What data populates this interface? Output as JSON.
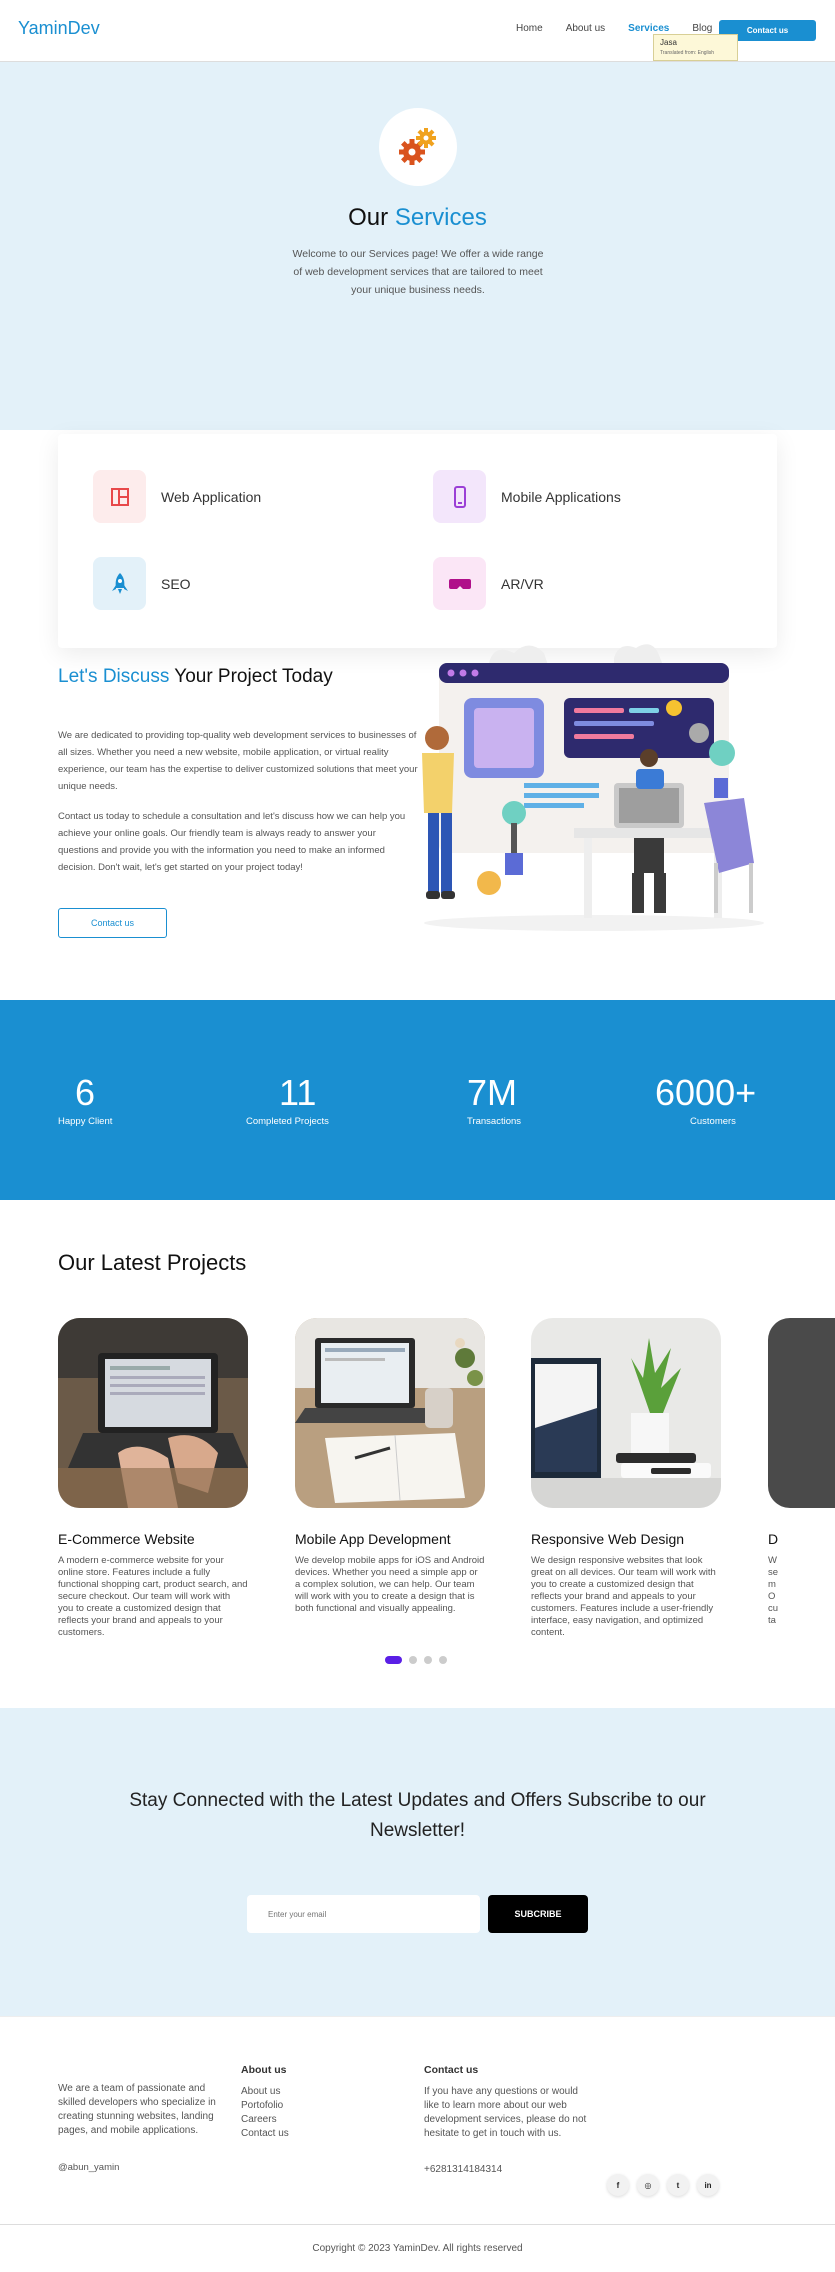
{
  "nav": {
    "logo": "YaminDev",
    "links": [
      "Home",
      "About us",
      "Services",
      "Blog"
    ],
    "cta": "Contact us",
    "tooltip": {
      "title": "Jasa",
      "sub": "Translated from: English"
    }
  },
  "hero": {
    "title_plain": "Our",
    "title_accent": "Services",
    "description": "Welcome to our Services page! We offer a wide range of web development services that are tailored to meet your unique business needs."
  },
  "services": [
    {
      "label": "Web Application",
      "icon": "web-layout-icon",
      "color": "#e8484a"
    },
    {
      "label": "Mobile Applications",
      "icon": "mobile-phone-icon",
      "color": "#9b3fd6"
    },
    {
      "label": "SEO",
      "icon": "rocket-icon",
      "color": "#1a8fd1"
    },
    {
      "label": "AR/VR",
      "icon": "vr-headset-icon",
      "color": "#b0108a"
    }
  ],
  "discuss": {
    "title_accent": "Let's Discuss",
    "title_plain": "Your Project Today",
    "p1": "We are dedicated to providing top-quality web development services to businesses of all sizes. Whether you need a new website, mobile application, or virtual reality experience, our team has the expertise to deliver customized solutions that meet your unique needs.",
    "p2": "Contact us today to schedule a consultation and let's discuss how we can help you achieve your online goals. Our friendly team is always ready to answer your questions and provide you with the information you need to make an informed decision. Don't wait, let's get started on your project today!",
    "button": "Contact us"
  },
  "stats": [
    {
      "value": "6",
      "label": "Happy Client"
    },
    {
      "value": "11",
      "label": "Completed Projects"
    },
    {
      "value": "7M",
      "label": "Transactions"
    },
    {
      "value": "6000+",
      "label": "Customers"
    }
  ],
  "projects": {
    "title": "Our Latest Projects",
    "items": [
      {
        "title": "E-Commerce Website",
        "desc": "A modern e-commerce website for your online store. Features include a fully functional shopping cart, product search, and secure checkout. Our team will work with you to create a customized design that reflects your brand and appeals to your customers."
      },
      {
        "title": "Mobile App Development",
        "desc": "We develop mobile apps for iOS and Android devices. Whether you need a simple app or a complex solution, we can help. Our team will work with you to create a design that is both functional and visually appealing."
      },
      {
        "title": "Responsive Web Design",
        "desc": "We design responsive websites that look great on all devices. Our team will work with you to create a customized design that reflects your brand and appeals to your customers. Features include a user-friendly interface, easy navigation, and optimized content."
      },
      {
        "title": "D",
        "desc": "W se m O cu ta"
      }
    ],
    "active_slide": 0,
    "slide_count": 4
  },
  "newsletter": {
    "title": "Stay Connected with the Latest Updates and Offers Subscribe to our Newsletter!",
    "placeholder": "Enter your email",
    "button": "SUBCRIBE"
  },
  "footer": {
    "about": "We are a team of passionate and skilled developers who specialize in creating stunning websites, landing pages, and mobile applications.",
    "handle": "@abun_yamin",
    "about_title": "About us",
    "about_links": [
      "About us",
      "Portofolio",
      "Careers",
      "Contact us"
    ],
    "contact_title": "Contact us",
    "contact_text": "If you have any questions or would like to learn more about our web development services, please do not hesitate to get in touch with us.",
    "phone": "+6281314184314",
    "socials": [
      {
        "icon": "facebook-icon",
        "glyph": "f"
      },
      {
        "icon": "instagram-icon",
        "glyph": "◎"
      },
      {
        "icon": "twitter-icon",
        "glyph": "t"
      },
      {
        "icon": "linkedin-icon",
        "glyph": "in"
      }
    ],
    "copyright": "Copyright © 2023 YaminDev. All rights reserved"
  }
}
